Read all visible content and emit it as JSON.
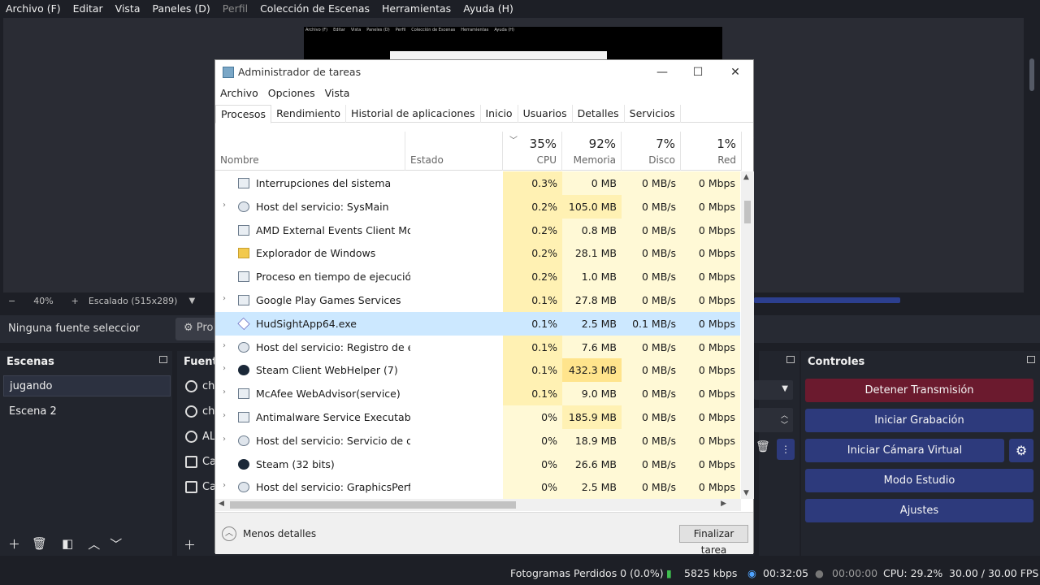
{
  "obs": {
    "menu": [
      "Archivo (F)",
      "Editar",
      "Vista",
      "Paneles (D)",
      "Perfil",
      "Colección de Escenas",
      "Herramientas",
      "Ayuda (H)"
    ],
    "preview_menu": [
      "Archivo (F)",
      "Editar",
      "Vista",
      "Paneles (D)",
      "Perfil",
      "Colección de Escenas",
      "Herramientas",
      "Ayuda (H)"
    ],
    "zoom": {
      "minus": "−",
      "percent": "40%",
      "plus": "+",
      "scale": "Escalado (515x289)"
    },
    "source_bar": {
      "none_selected": "Ninguna fuente seleccionada",
      "properties": "Pro"
    },
    "scenes": {
      "title": "Escenas",
      "items": [
        "jugando",
        "Escena 2"
      ]
    },
    "sources": {
      "title": "Fuent",
      "items": [
        "ch",
        "ch",
        "AL",
        "Ca",
        "Ca"
      ]
    },
    "controls": {
      "title": "Controles",
      "stop_stream": "Detener Transmisión",
      "start_recording": "Iniciar Grabación",
      "start_virtual_cam": "Iniciar Cámara Virtual",
      "studio_mode": "Modo Estudio",
      "settings": "Ajustes"
    },
    "status": {
      "dropped": "Fotogramas Perdidos 0 (0.0%)",
      "bitrate": "5825 kbps",
      "stream_time": "00:32:05",
      "rec_time": "00:00:00",
      "cpu": "CPU: 29.2%",
      "fps": "30.00 / 30.00 FPS"
    },
    "colors": {
      "accent": "#2d3a7c",
      "stop": "#6b1a2e",
      "bg": "#1d1f26"
    }
  },
  "taskmgr": {
    "title": "Administrador de tareas",
    "window_buttons": {
      "minimize": "—",
      "maximize": "☐",
      "close": "✕"
    },
    "menu": [
      "Archivo",
      "Opciones",
      "Vista"
    ],
    "tabs": [
      "Procesos",
      "Rendimiento",
      "Historial de aplicaciones",
      "Inicio",
      "Usuarios",
      "Detalles",
      "Servicios"
    ],
    "header": {
      "name": "Nombre",
      "status": "Estado",
      "cpu_pct": "35%",
      "cpu": "CPU",
      "mem_pct": "92%",
      "mem": "Memoria",
      "disk_pct": "7%",
      "disk": "Disco",
      "net_pct": "1%",
      "net": "Red"
    },
    "rows": [
      {
        "name": "Interrupciones del sistema",
        "cpu": "0.3%",
        "mem": "0 MB",
        "disk": "0 MB/s",
        "net": "0 Mbps",
        "expandable": false,
        "icon": "window-icon"
      },
      {
        "name": "Host del servicio: SysMain",
        "cpu": "0.2%",
        "mem": "105.0 MB",
        "disk": "0 MB/s",
        "net": "0 Mbps",
        "expandable": true,
        "icon": "gear-icon"
      },
      {
        "name": "AMD External Events Client Mo...",
        "cpu": "0.2%",
        "mem": "0.8 MB",
        "disk": "0 MB/s",
        "net": "0 Mbps",
        "expandable": false,
        "icon": "window-icon"
      },
      {
        "name": "Explorador de Windows",
        "cpu": "0.2%",
        "mem": "28.1 MB",
        "disk": "0 MB/s",
        "net": "0 Mbps",
        "expandable": false,
        "icon": "folder-icon"
      },
      {
        "name": "Proceso en tiempo de ejecución...",
        "cpu": "0.2%",
        "mem": "1.0 MB",
        "disk": "0 MB/s",
        "net": "0 Mbps",
        "expandable": false,
        "icon": "window-icon"
      },
      {
        "name": "Google Play Games Services",
        "cpu": "0.1%",
        "mem": "27.8 MB",
        "disk": "0 MB/s",
        "net": "0 Mbps",
        "expandable": true,
        "icon": "window-icon"
      },
      {
        "name": "HudSightApp64.exe",
        "cpu": "0.1%",
        "mem": "2.5 MB",
        "disk": "0.1 MB/s",
        "net": "0 Mbps",
        "expandable": false,
        "icon": "diamond-icon",
        "selected": true
      },
      {
        "name": "Host del servicio: Registro de ev...",
        "cpu": "0.1%",
        "mem": "7.6 MB",
        "disk": "0 MB/s",
        "net": "0 Mbps",
        "expandable": true,
        "icon": "gear-icon"
      },
      {
        "name": "Steam Client WebHelper (7)",
        "cpu": "0.1%",
        "mem": "432.3 MB",
        "disk": "0 MB/s",
        "net": "0 Mbps",
        "expandable": true,
        "icon": "steam-icon"
      },
      {
        "name": "McAfee WebAdvisor(service)",
        "cpu": "0.1%",
        "mem": "9.0 MB",
        "disk": "0 MB/s",
        "net": "0 Mbps",
        "expandable": true,
        "icon": "window-icon"
      },
      {
        "name": "Antimalware Service Executable",
        "cpu": "0%",
        "mem": "185.9 MB",
        "disk": "0 MB/s",
        "net": "0 Mbps",
        "expandable": true,
        "icon": "window-icon"
      },
      {
        "name": "Host del servicio: Servicio de dir...",
        "cpu": "0%",
        "mem": "18.9 MB",
        "disk": "0 MB/s",
        "net": "0 Mbps",
        "expandable": true,
        "icon": "gear-icon"
      },
      {
        "name": "Steam (32 bits)",
        "cpu": "0%",
        "mem": "26.6 MB",
        "disk": "0 MB/s",
        "net": "0 Mbps",
        "expandable": false,
        "icon": "steam-icon"
      },
      {
        "name": "Host del servicio: GraphicsPerfSvc",
        "cpu": "0%",
        "mem": "2.5 MB",
        "disk": "0 MB/s",
        "net": "0 Mbps",
        "expandable": true,
        "icon": "gear-icon"
      }
    ],
    "footer": {
      "less_details": "Menos detalles",
      "end_task": "Finalizar tarea"
    },
    "colors": {
      "heat_low": "#fff9d6",
      "heat_mid": "#fff1b3",
      "heat_high": "#ffe48c",
      "selected": "#cce8ff"
    }
  }
}
